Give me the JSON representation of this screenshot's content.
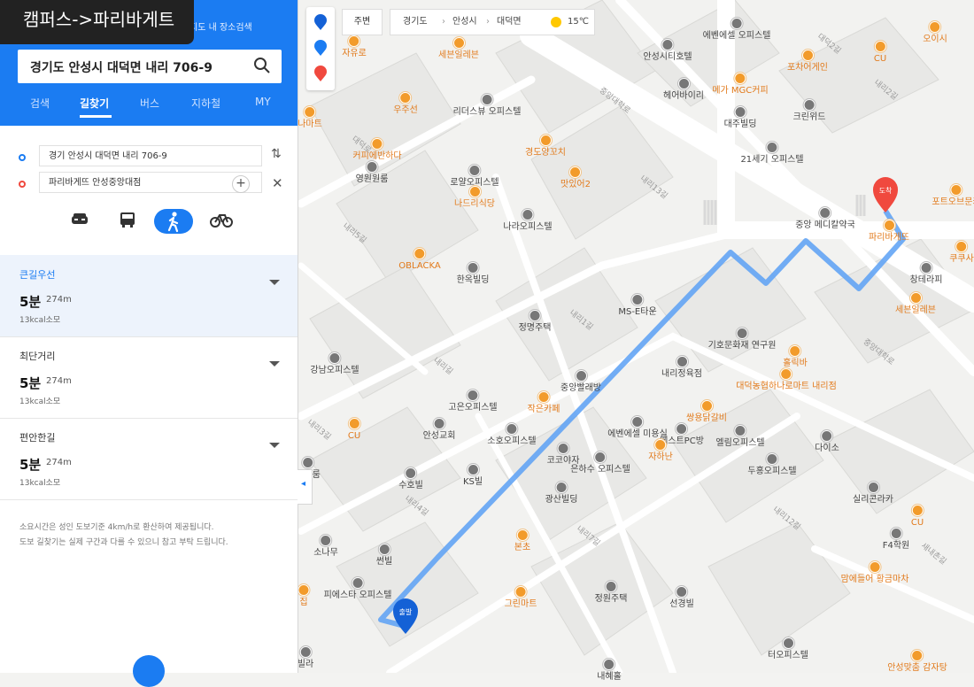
{
  "title_overlay": "캠퍼스->파리바게트",
  "header": {
    "top_label": "지도 내 장소검색",
    "search_value": "경기도 안성시 대덕면 내리 706-9",
    "tabs": [
      "검색",
      "길찾기",
      "버스",
      "지하철",
      "MY"
    ],
    "active_tab": "길찾기"
  },
  "route": {
    "origin": "경기 안성시 대덕면 내리 706-9",
    "destination": "파리바게뜨 안성중앙대점",
    "modes": [
      "car-icon",
      "bus-icon",
      "walk-icon",
      "bike-icon"
    ],
    "active_mode": "walk-icon"
  },
  "options": [
    {
      "name": "큰길우선",
      "time": "5분",
      "dist": "274m",
      "kcal": "13kcal소모"
    },
    {
      "name": "최단거리",
      "time": "5분",
      "dist": "274m",
      "kcal": "13kcal소모"
    },
    {
      "name": "편안한길",
      "time": "5분",
      "dist": "274m",
      "kcal": "13kcal소모"
    }
  ],
  "notes": [
    "소요시간은 성인 도보기준 4km/h로 환산하여 제공됩니다.",
    "도보 길찾기는 실제 구간과 다를 수 있으니 참고 부탁 드립니다."
  ],
  "map_controls": {
    "pins": [
      "출",
      "경",
      "도"
    ],
    "nearby_label": "주변",
    "breadcrumb": [
      "경기도",
      "안성시",
      "대덕면"
    ],
    "weather": "15℃"
  },
  "markers": {
    "start": "출발",
    "end": "도착"
  },
  "places": [
    {
      "label": "에벤에셀 오피스텔",
      "kind": "g"
    },
    {
      "label": "오이시",
      "kind": "o"
    },
    {
      "label": "CU",
      "kind": "o"
    },
    {
      "label": "자유로",
      "kind": "o"
    },
    {
      "label": "세븐일레븐",
      "kind": "o"
    },
    {
      "label": "안성시티호텔",
      "kind": "g"
    },
    {
      "label": "포차어게인",
      "kind": "o"
    },
    {
      "label": "메가 MGC커피",
      "kind": "o"
    },
    {
      "label": "헤어바이리",
      "kind": "g"
    },
    {
      "label": "리더스뷰 오피스텔",
      "kind": "g"
    },
    {
      "label": "우주선",
      "kind": "o"
    },
    {
      "label": "대주빌딩",
      "kind": "g"
    },
    {
      "label": "크린위드",
      "kind": "g"
    },
    {
      "label": "커피에반하다",
      "kind": "o"
    },
    {
      "label": "영원원룸",
      "kind": "g"
    },
    {
      "label": "경도양꼬치",
      "kind": "o"
    },
    {
      "label": "21세기 오피스텔",
      "kind": "g"
    },
    {
      "label": "로얄오피스텔",
      "kind": "g"
    },
    {
      "label": "맛있어2",
      "kind": "o"
    },
    {
      "label": "나드리식당",
      "kind": "o"
    },
    {
      "label": "포트오브문카",
      "kind": "o"
    },
    {
      "label": "중앙 메디칼약국",
      "kind": "g"
    },
    {
      "label": "나라오피스텔",
      "kind": "g"
    },
    {
      "label": "파리바게뜨",
      "kind": "o"
    },
    {
      "label": "OBLACKA",
      "kind": "o"
    },
    {
      "label": "한옥빌딩",
      "kind": "g"
    },
    {
      "label": "쿠쿠사",
      "kind": "o"
    },
    {
      "label": "창테라피",
      "kind": "g"
    },
    {
      "label": "MS-E타운",
      "kind": "g"
    },
    {
      "label": "세븐일레븐",
      "kind": "o"
    },
    {
      "label": "정명주택",
      "kind": "g"
    },
    {
      "label": "기호문화재 연구원",
      "kind": "g"
    },
    {
      "label": "강남오피스텔",
      "kind": "g"
    },
    {
      "label": "홀릭바",
      "kind": "o"
    },
    {
      "label": "내리정육점",
      "kind": "g"
    },
    {
      "label": "중앙빨래방",
      "kind": "g"
    },
    {
      "label": "대덕농협하나로마트 내리점",
      "kind": "o"
    },
    {
      "label": "고은오피스텔",
      "kind": "g"
    },
    {
      "label": "작은카페",
      "kind": "o"
    },
    {
      "label": "쌍용닭갈비",
      "kind": "o"
    },
    {
      "label": "안성교회",
      "kind": "g"
    },
    {
      "label": "소호오피스텔",
      "kind": "g"
    },
    {
      "label": "에벤에셀 미용실",
      "kind": "g"
    },
    {
      "label": "베스트PC방",
      "kind": "g"
    },
    {
      "label": "엘림오피스텔",
      "kind": "g"
    },
    {
      "label": "다이소",
      "kind": "g"
    },
    {
      "label": "CU",
      "kind": "o"
    },
    {
      "label": "코코야자",
      "kind": "g"
    },
    {
      "label": "은하수 오피스텔",
      "kind": "g"
    },
    {
      "label": "자하난",
      "kind": "o"
    },
    {
      "label": "수호빌",
      "kind": "g"
    },
    {
      "label": "KS빌",
      "kind": "g"
    },
    {
      "label": "두홍오피스텔",
      "kind": "g"
    },
    {
      "label": "광산빌딩",
      "kind": "g"
    },
    {
      "label": "실리콘라카",
      "kind": "g"
    },
    {
      "label": "CU",
      "kind": "o"
    },
    {
      "label": "소나무",
      "kind": "g"
    },
    {
      "label": "썬빌",
      "kind": "g"
    },
    {
      "label": "본초",
      "kind": "o"
    },
    {
      "label": "F4학원",
      "kind": "g"
    },
    {
      "label": "맘에들어 황금마차",
      "kind": "o"
    },
    {
      "label": "피에스타 오피스텔",
      "kind": "g"
    },
    {
      "label": "정원주택",
      "kind": "g"
    },
    {
      "label": "선경빌",
      "kind": "g"
    },
    {
      "label": "그린마트",
      "kind": "o"
    },
    {
      "label": "터오피스텔",
      "kind": "g"
    },
    {
      "label": "내혜홀",
      "kind": "g"
    },
    {
      "label": "안성맞춤 감자탕",
      "kind": "o"
    },
    {
      "label": "나마트",
      "kind": "o"
    },
    {
      "label": "아원룸",
      "kind": "g"
    },
    {
      "label": "집",
      "kind": "o"
    },
    {
      "label": "빌라",
      "kind": "g"
    }
  ],
  "roads": [
    {
      "label": "중앙대학로"
    },
    {
      "label": "대덕로"
    },
    {
      "label": "내리길"
    },
    {
      "label": "내리1길"
    },
    {
      "label": "내리12길"
    },
    {
      "label": "내리2길"
    },
    {
      "label": "내리7길"
    },
    {
      "label": "내리3길"
    },
    {
      "label": "내리4길"
    },
    {
      "label": "내리5길"
    },
    {
      "label": "내리13길"
    },
    {
      "label": "새내촌길"
    },
    {
      "label": "중앙대학로"
    },
    {
      "label": "대덕2길"
    }
  ]
}
